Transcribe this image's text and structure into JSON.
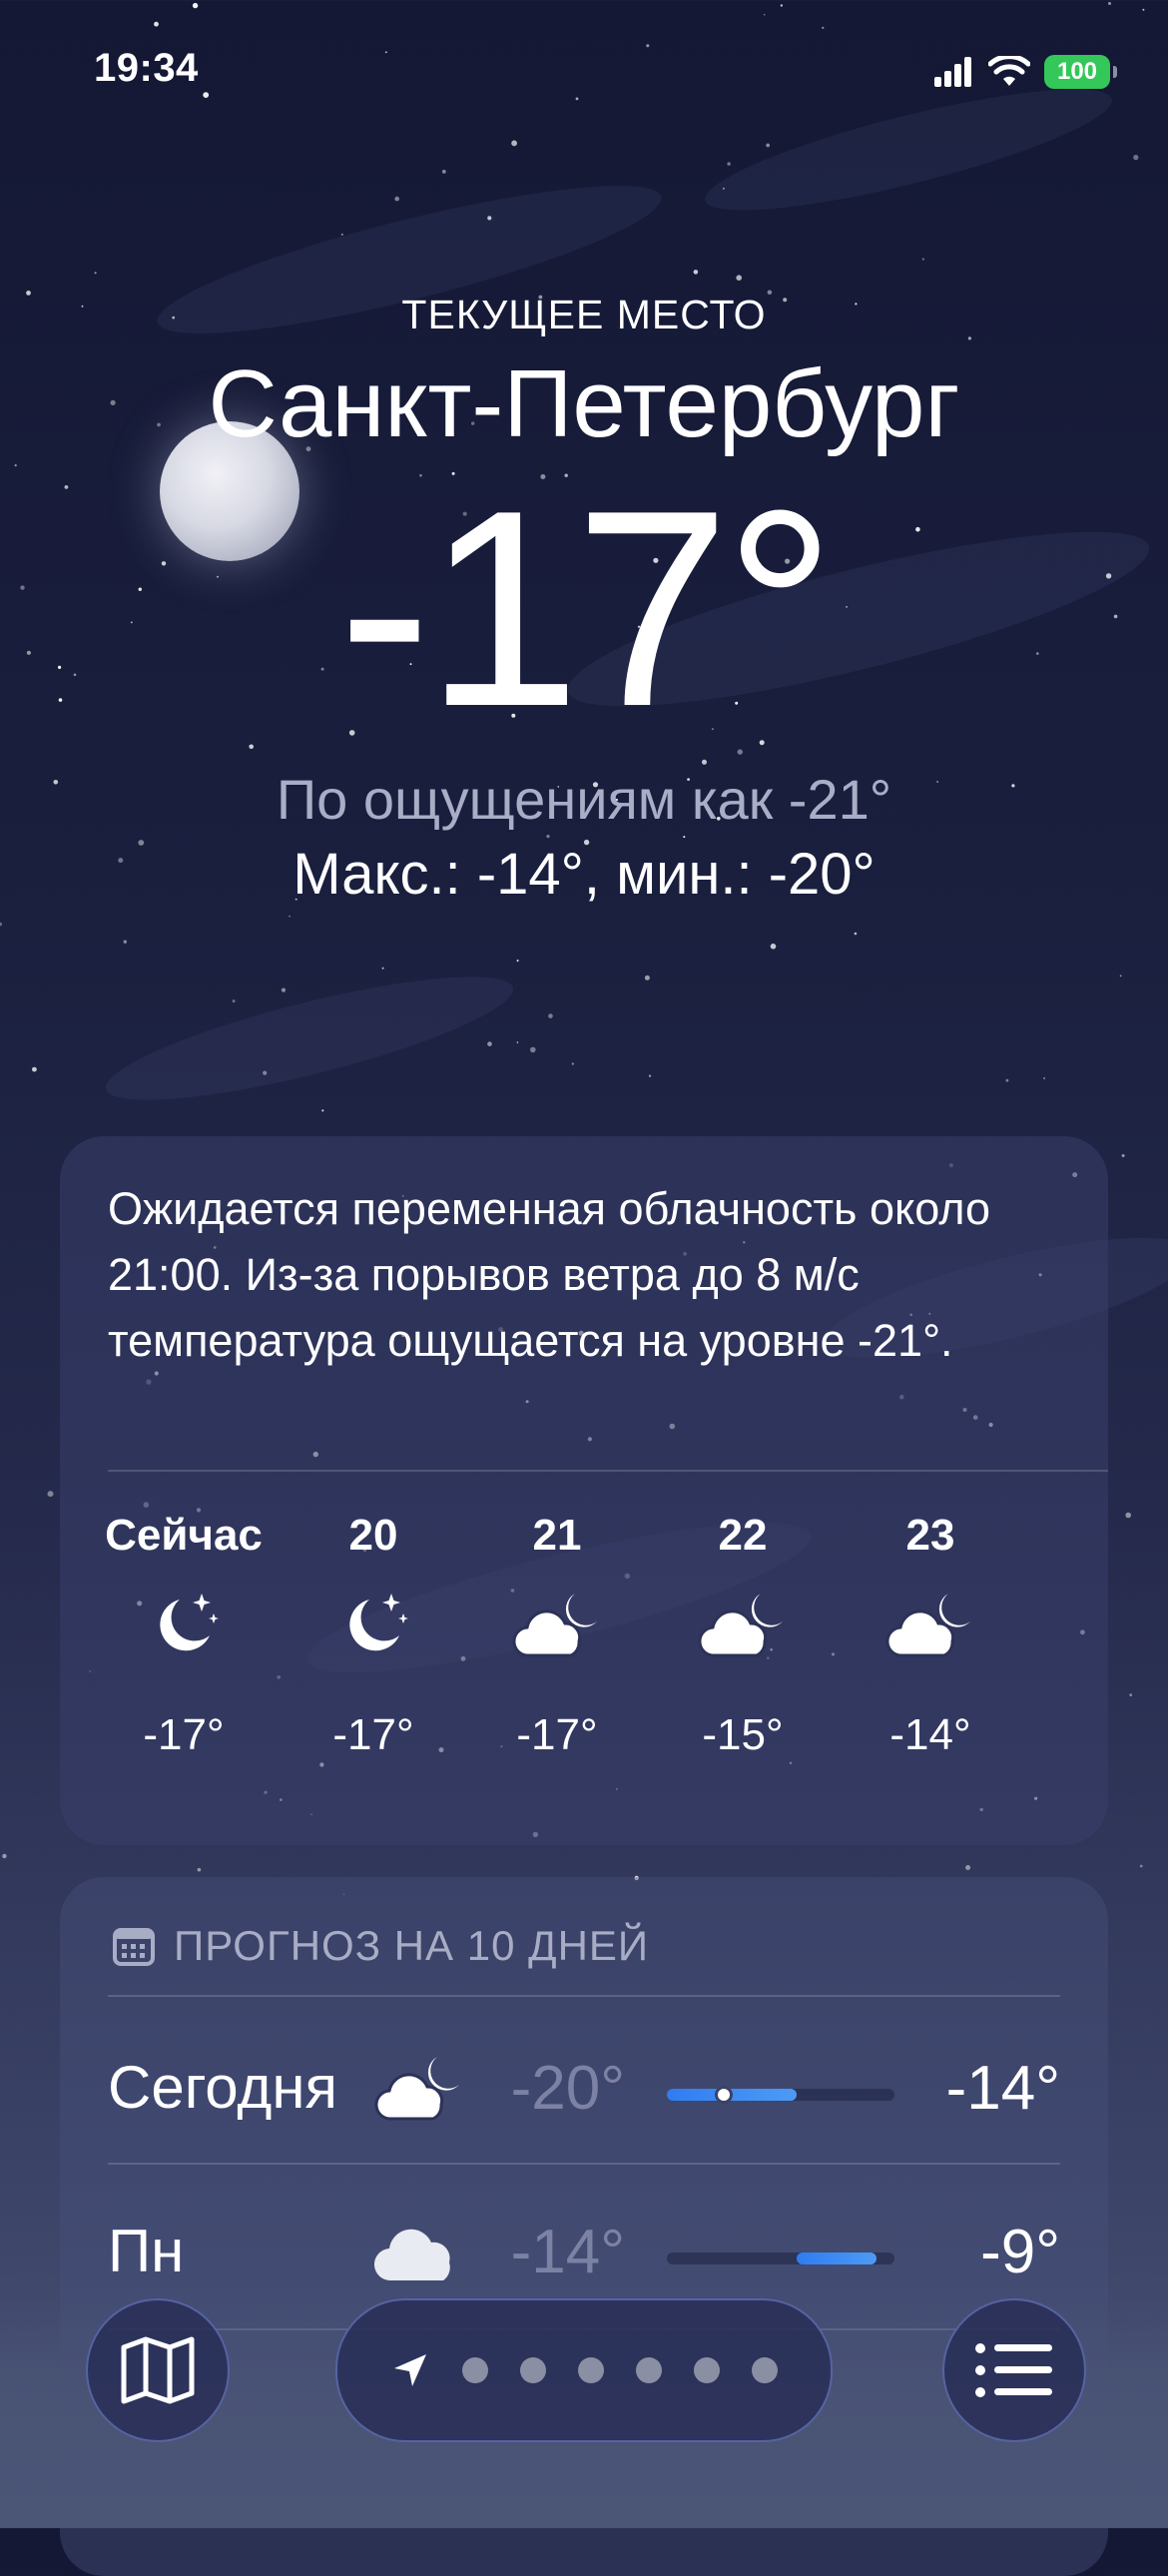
{
  "status_bar": {
    "time": "19:34",
    "battery": "100"
  },
  "location": {
    "caption": "ТЕКУЩЕЕ МЕСТО",
    "city": "Санкт-Петербург"
  },
  "current": {
    "temperature": "-17°",
    "feels_like": "По ощущениям как -21°",
    "high_low": "Макс.: -14°, мин.: -20°"
  },
  "hourly": {
    "summary": "Ожидается переменная облачность около 21:00. Из-за порывов ветра до 8 м/с температура ощущается на уровне -21°.",
    "items": [
      {
        "label": "Сейчас",
        "icon": "moon-stars-icon",
        "temp": "-17°"
      },
      {
        "label": "20",
        "icon": "moon-stars-icon",
        "temp": "-17°"
      },
      {
        "label": "21",
        "icon": "cloud-moon-icon",
        "temp": "-17°"
      },
      {
        "label": "22",
        "icon": "cloud-moon-icon",
        "temp": "-15°"
      },
      {
        "label": "23",
        "icon": "cloud-moon-icon",
        "temp": "-14°"
      }
    ]
  },
  "daily": {
    "title": "ПРОГНОЗ НА 10 ДНЕЙ",
    "icon": "calendar-icon",
    "days": [
      {
        "name": "Сегодня",
        "icon": "cloud-moon-icon",
        "min": "-20°",
        "max": "-14°",
        "range_start": 0.0,
        "range_end": 0.57,
        "current_pos": 0.25
      },
      {
        "name": "Пн",
        "icon": "cloud-icon",
        "min": "-14°",
        "max": "-9°",
        "range_start": 0.57,
        "range_end": 0.92
      }
    ]
  },
  "toolbar": {
    "map_icon": "map-icon",
    "location_icon": "location-arrow-icon",
    "list_icon": "list-icon",
    "page_dots": 6
  },
  "colors": {
    "accent_blue": "#3a86f2",
    "battery_green": "#34c759"
  }
}
